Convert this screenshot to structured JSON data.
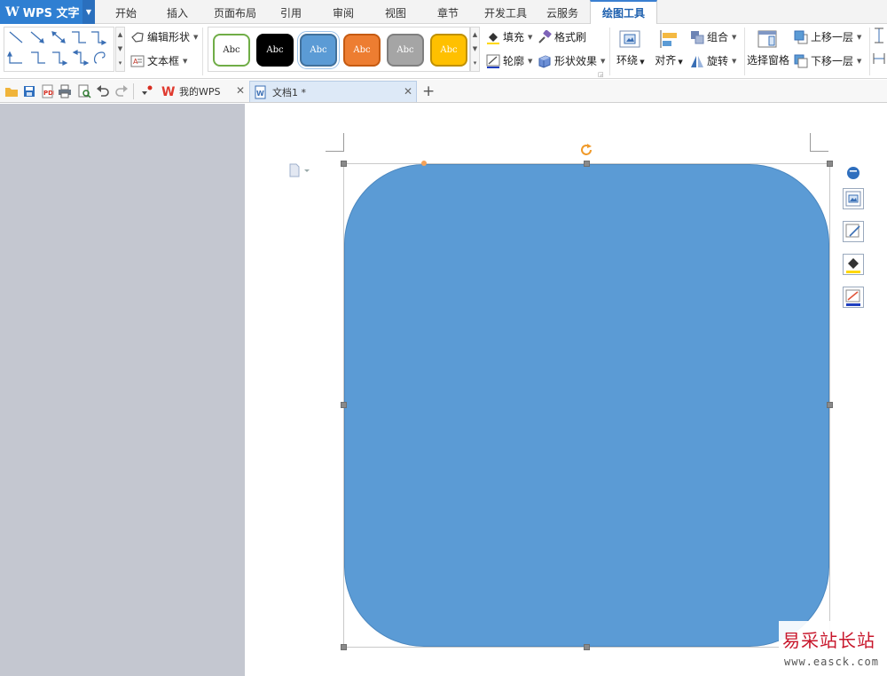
{
  "app": {
    "title": "WPS 文字",
    "logo_letter": "W"
  },
  "menu_tabs": [
    "开始",
    "插入",
    "页面布局",
    "引用",
    "审阅",
    "视图",
    "章节",
    "开发工具",
    "云服务",
    "绘图工具"
  ],
  "ribbon": {
    "edit_shape": "编辑形状",
    "text_box": "文本框",
    "style_chips": [
      {
        "label": "Abc",
        "bg": "#ffffff",
        "fg": "#222222",
        "border": "#70ad47"
      },
      {
        "label": "Abc",
        "bg": "#000000",
        "fg": "#ffffff",
        "border": "#000000"
      },
      {
        "label": "Abc",
        "bg": "#5b9bd5",
        "fg": "#ffffff",
        "border": "#41719c"
      },
      {
        "label": "Abc",
        "bg": "#ed7d31",
        "fg": "#ffffff",
        "border": "#c55a11"
      },
      {
        "label": "Abc",
        "bg": "#a5a5a5",
        "fg": "#ffffff",
        "border": "#7f7f7f"
      },
      {
        "label": "Abc",
        "bg": "#ffc000",
        "fg": "#ffffff",
        "border": "#bf9000"
      }
    ],
    "fill": "填充",
    "outline": "轮廓",
    "format_painter": "格式刷",
    "shape_effects": "形状效果",
    "wrap": "环绕",
    "align": "对齐",
    "group": "组合",
    "rotate": "旋转",
    "selection_pane": "选择窗格",
    "bring_forward": "上移一层",
    "send_backward": "下移一层"
  },
  "doc_tabs": [
    {
      "label": "我的WPS",
      "active": false
    },
    {
      "label": "文档1 *",
      "active": true
    }
  ],
  "shape": {
    "type": "rounded-rectangle",
    "fill": "#5b9bd5",
    "outline": "#4a86be"
  },
  "colors": {
    "accent": "#2f7fd2",
    "active_tab_text": "#1c5fae",
    "left_pane": "#c4c7d0"
  },
  "watermark": {
    "name": "易采站长站",
    "url": "www.easck.com"
  }
}
